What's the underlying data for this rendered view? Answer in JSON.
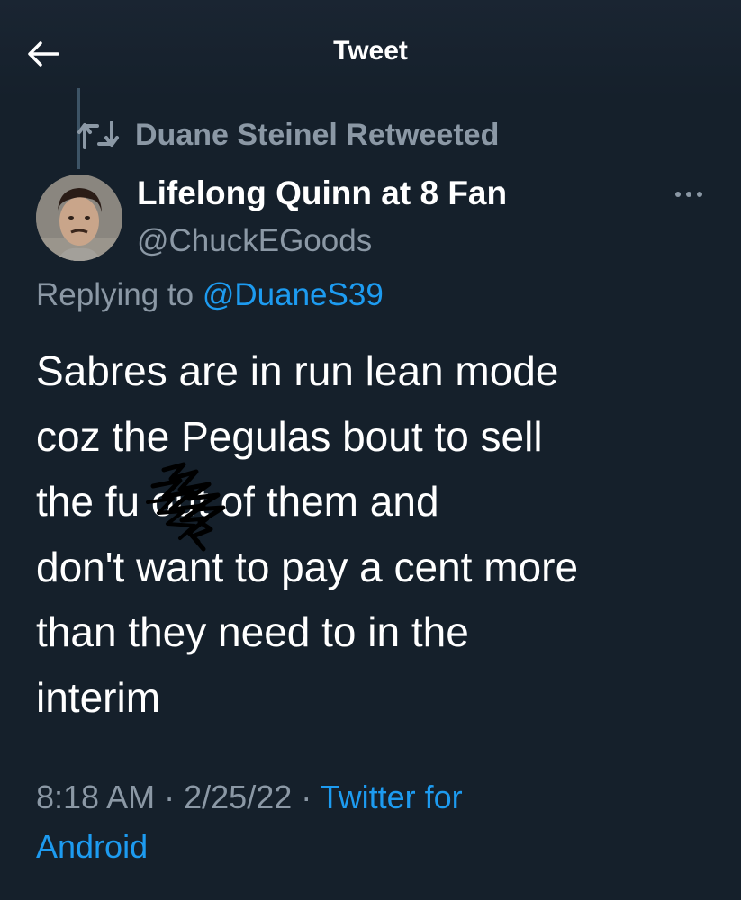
{
  "header": {
    "title": "Tweet"
  },
  "retweet": {
    "label": "Duane Steinel Retweeted"
  },
  "author": {
    "display_name": "Lifelong Quinn at 8 Fan",
    "handle": "@ChuckEGoods"
  },
  "reply": {
    "prefix": "Replying to",
    "mention": "@DuaneS39"
  },
  "tweet": {
    "lines": [
      "Sabres are in run lean mode",
      "coz the Pegulas bout to sell",
      "the fu    out of them and",
      "don't want to pay a cent more",
      "than they need to in the",
      "interim"
    ]
  },
  "meta": {
    "time": "8:18 AM",
    "date": "2/25/22",
    "source_part1": "Twitter for",
    "source_part2": "Android"
  },
  "colors": {
    "background": "#15202b",
    "secondary_text": "#8b98a5",
    "accent": "#1d9bf0"
  },
  "icons": [
    "back-arrow-icon",
    "retweet-icon",
    "more-options-icon"
  ]
}
